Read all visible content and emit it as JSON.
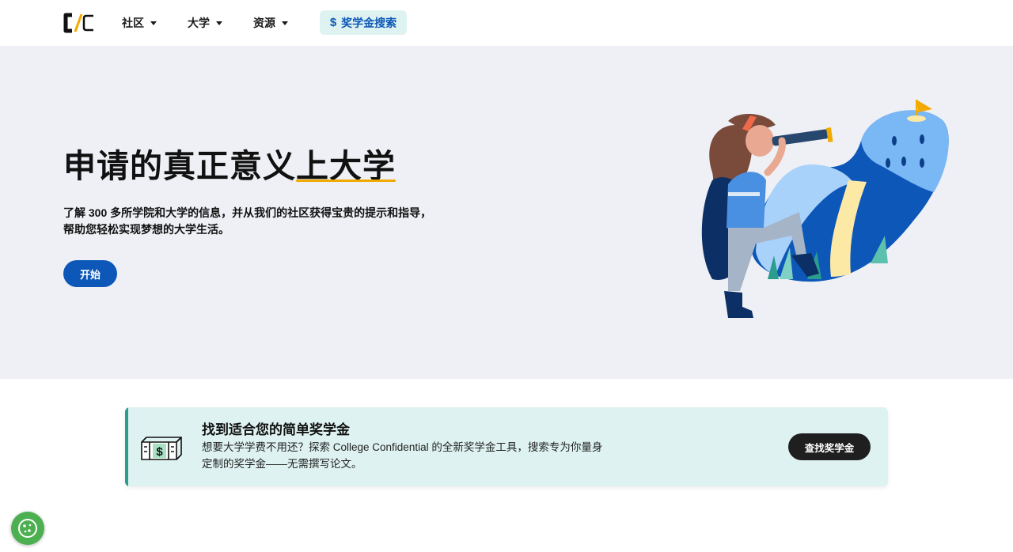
{
  "header": {
    "logo_text": "C/C",
    "nav": [
      {
        "label": "社区"
      },
      {
        "label": "大学"
      },
      {
        "label": "资源"
      }
    ],
    "scholarship_search_label": "奖学金搜索",
    "scholarship_icon": "dollar-icon"
  },
  "hero": {
    "title": "申请的真正意义上大学",
    "description_line1": "了解 300 多所学院和大学的信息，并从我们的社区获得宝贵的提示和指导，",
    "description_line2": "帮助您轻松实现梦想的大学生活。",
    "start_button": "开始",
    "illustration": "girl-with-telescope-illustration"
  },
  "scholarship_card": {
    "icon": "cash-stack-icon",
    "title": "找到适合您的简单奖学金",
    "description_line1": "想要大学学费不用还？探索 College Confidential 的全新奖学金工具，搜索专为你量身",
    "description_line2": "定制的奖学金——无需撰写论文。",
    "button": "查找奖学金"
  },
  "cookie_button": {
    "icon": "cookie-icon"
  },
  "colors": {
    "brand_blue": "#0c57b8",
    "accent_yellow": "#f2a900",
    "card_bg": "#def3f1",
    "card_accent": "#2a9d8f",
    "hero_bg": "#eef0f5",
    "cookie_green": "#4caf50"
  }
}
